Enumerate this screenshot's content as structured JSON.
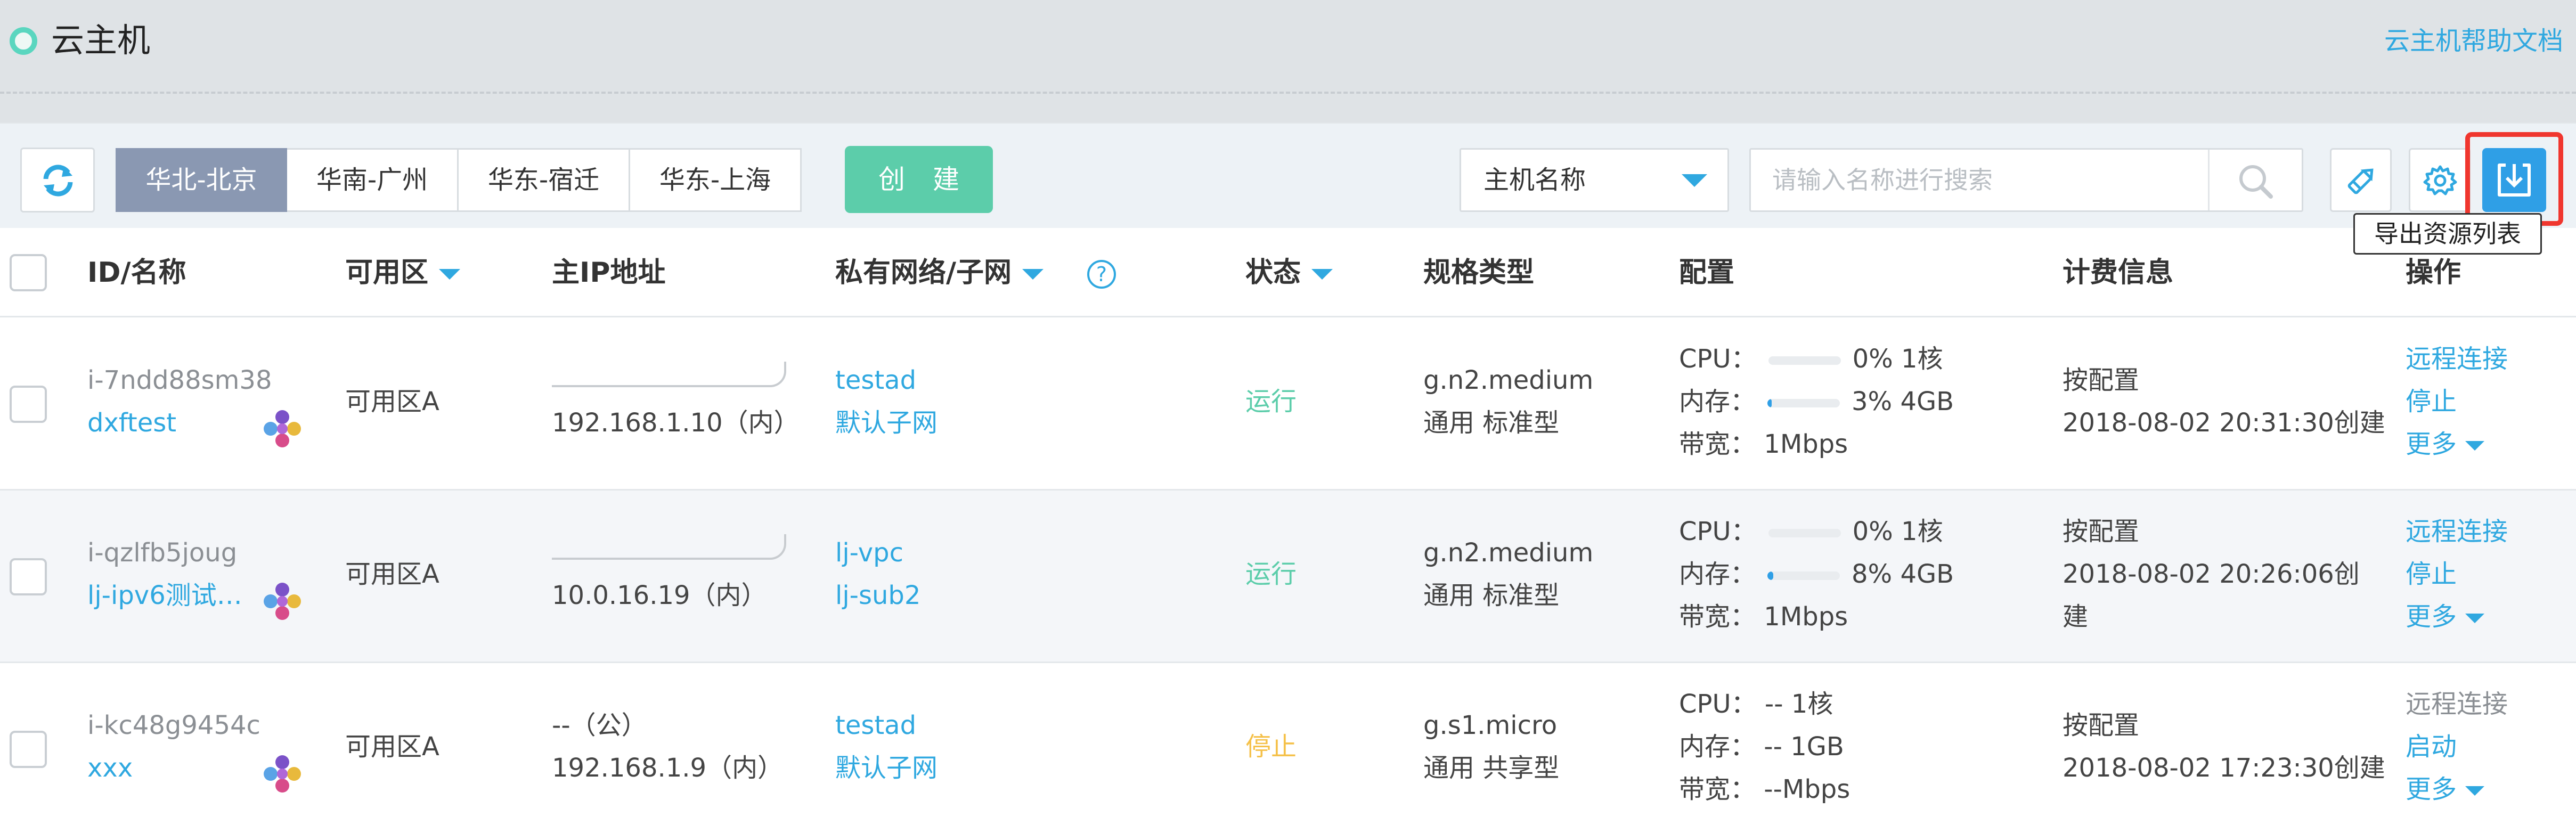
{
  "header": {
    "title": "云主机",
    "help_link": "云主机帮助文档"
  },
  "toolbar": {
    "regions": [
      "华北-北京",
      "华南-广州",
      "华东-宿迁",
      "华东-上海"
    ],
    "active_region_index": 0,
    "create_label": "创 建",
    "filter_select": "主机名称",
    "search_placeholder": "请输入名称进行搜索",
    "export_tooltip": "导出资源列表"
  },
  "table": {
    "columns": {
      "id_name": "ID/名称",
      "zone": "可用区",
      "ip": "主IP地址",
      "vpc": "私有网络/子网",
      "status": "状态",
      "spec": "规格类型",
      "config": "配置",
      "billing": "计费信息",
      "actions": "操作"
    },
    "rows": [
      {
        "id": "i-7ndd88sm38",
        "name": "dxftest",
        "zone": "可用区A",
        "ip_public": "",
        "ip_private": "192.168.1.10（内）",
        "vpc": "testad",
        "subnet": "默认子网",
        "status": "运行",
        "spec_code": "g.n2.medium",
        "spec_type": "通用 标准型",
        "cpu_label": "CPU：",
        "cpu_usage": "0%",
        "cpu_usage_fraction": 0.0,
        "cpu_cores": "1核",
        "mem_label": "内存：",
        "mem_usage": "3%",
        "mem_usage_fraction": 0.03,
        "mem_size": "4GB",
        "bw_label": "带宽：",
        "bandwidth": "1Mbps",
        "billing_type": "按配置",
        "created": "2018-08-02 20:31:30创建",
        "action_remote": "远程连接",
        "action_power": "停止",
        "action_more": "更多"
      },
      {
        "id": "i-qzlfb5joug",
        "name": "lj-ipv6测试…",
        "zone": "可用区A",
        "ip_public": "",
        "ip_private": "10.0.16.19（内）",
        "vpc": "lj-vpc",
        "subnet": "lj-sub2",
        "status": "运行",
        "spec_code": "g.n2.medium",
        "spec_type": "通用 标准型",
        "cpu_label": "CPU：",
        "cpu_usage": "0%",
        "cpu_usage_fraction": 0.0,
        "cpu_cores": "1核",
        "mem_label": "内存：",
        "mem_usage": "8%",
        "mem_usage_fraction": 0.08,
        "mem_size": "4GB",
        "bw_label": "带宽：",
        "bandwidth": "1Mbps",
        "billing_type": "按配置",
        "created": "2018-08-02 20:26:06创",
        "created_cont": "建",
        "action_remote": "远程连接",
        "action_power": "停止",
        "action_more": "更多"
      },
      {
        "id": "i-kc48g9454c",
        "name": "xxx",
        "zone": "可用区A",
        "ip_public": "--（公）",
        "ip_private": "192.168.1.9（内）",
        "vpc": "testad",
        "subnet": "默认子网",
        "status": "停止",
        "spec_code": "g.s1.micro",
        "spec_type": "通用 共享型",
        "cpu_label": "CPU：",
        "cpu_usage": "--",
        "cpu_cores": "1核",
        "mem_label": "内存：",
        "mem_usage": "--",
        "mem_size": "1GB",
        "bw_label": "带宽：",
        "bandwidth": "--Mbps",
        "billing_type": "按配置",
        "created": "2018-08-02 17:23:30创建",
        "action_remote": "远程连接",
        "action_power": "启动",
        "action_more": "更多"
      }
    ]
  },
  "colors": {
    "accent": "#2fa8e0",
    "create_button": "#5ccdaa",
    "running": "#5ccdaa",
    "stopped": "#f5c14a",
    "active_region": "#8a98b2",
    "highlight": "#f0362e"
  },
  "icons": {
    "refresh": "refresh-icon",
    "search": "search-icon",
    "edit": "pencil-icon",
    "settings": "gear-icon",
    "export": "download-icon",
    "avatar": "pinwheel-avatar-icon"
  }
}
